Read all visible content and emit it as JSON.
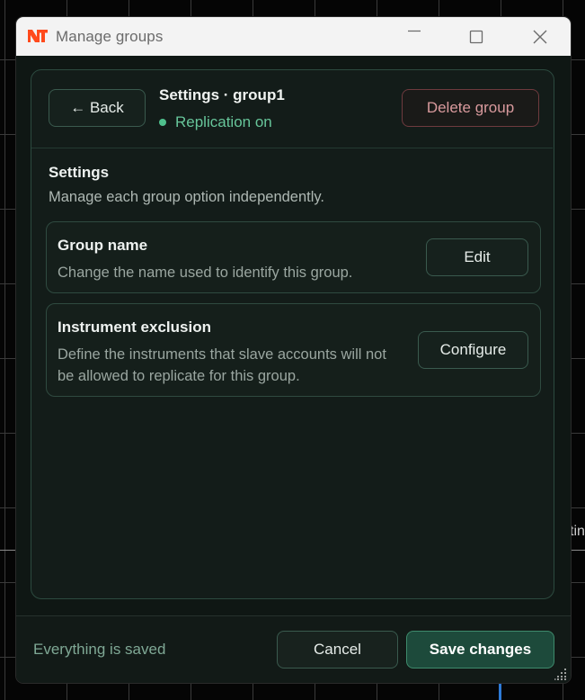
{
  "window": {
    "title": "Manage groups"
  },
  "background": {
    "partial_text": "tin"
  },
  "header": {
    "back_label": "← Back",
    "title": "Settings · group1",
    "status": "Replication on",
    "delete_label": "Delete group"
  },
  "settings": {
    "title": "Settings",
    "subtitle": "Manage each group option independently.",
    "options": [
      {
        "title": "Group name",
        "description": "Change the name used to identify this group.",
        "action_label": "Edit"
      },
      {
        "title": "Instrument exclusion",
        "description": "Define the instruments that slave accounts will not be allowed to replicate for this group.",
        "action_label": "Configure"
      }
    ]
  },
  "footer": {
    "status": "Everything is saved",
    "cancel_label": "Cancel",
    "save_label": "Save changes"
  },
  "colors": {
    "accent_green": "#4fc08d",
    "danger": "#d99a9d",
    "logo": "#ff4a1c"
  }
}
